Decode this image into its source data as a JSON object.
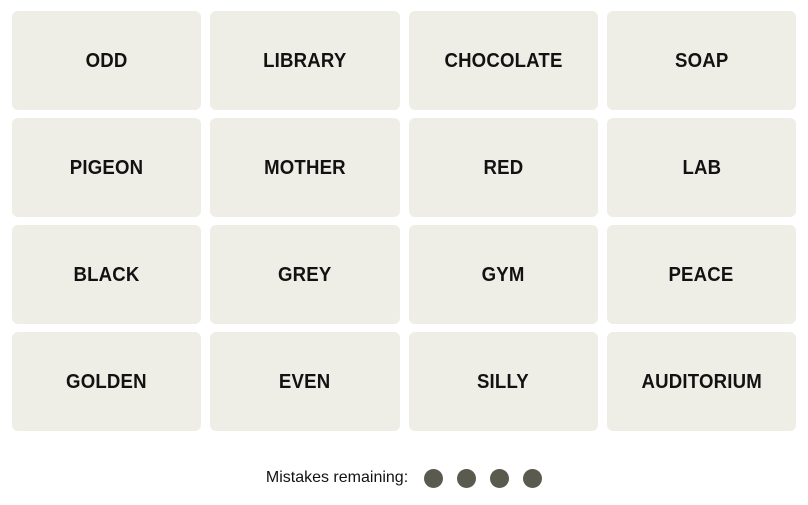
{
  "board": {
    "tile_bg": "#EFEEE6",
    "tile_text_color": "#121212",
    "page_bg": "#FFFFFF",
    "rows": [
      [
        "ODD",
        "LIBRARY",
        "CHOCOLATE",
        "SOAP"
      ],
      [
        "PIGEON",
        "MOTHER",
        "RED",
        "LAB"
      ],
      [
        "BLACK",
        "GREY",
        "GYM",
        "PEACE"
      ],
      [
        "GOLDEN",
        "EVEN",
        "SILLY",
        "AUDITORIUM"
      ]
    ],
    "tiles": [
      "ODD",
      "LIBRARY",
      "CHOCOLATE",
      "SOAP",
      "PIGEON",
      "MOTHER",
      "RED",
      "LAB",
      "BLACK",
      "GREY",
      "GYM",
      "PEACE",
      "GOLDEN",
      "EVEN",
      "SILLY",
      "AUDITORIUM"
    ]
  },
  "footer": {
    "mistakes_label": "Mistakes remaining:",
    "mistakes_remaining": 4,
    "dot_color": "#5A5A4E",
    "dots": [
      "dot-1",
      "dot-2",
      "dot-3",
      "dot-4"
    ]
  }
}
